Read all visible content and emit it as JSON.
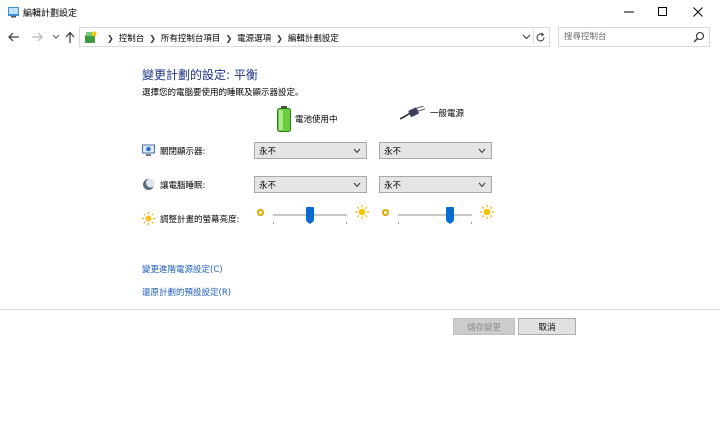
{
  "window": {
    "title": "編輯計劃設定"
  },
  "address": {
    "crumbs": [
      "控制台",
      "所有控制台項目",
      "電源選項",
      "編輯計劃設定"
    ],
    "search_placeholder": "搜尋控制台"
  },
  "page": {
    "title": "變更計劃的設定: 平衡",
    "subtitle": "選擇您的電腦要使用的睡眠及顯示器設定。"
  },
  "columns": {
    "battery": "電池使用中",
    "plugged": "一般電源"
  },
  "rows": {
    "display": {
      "label": "關閉顯示器:",
      "battery": "永不",
      "plugged": "永不"
    },
    "sleep": {
      "label": "讓電腦睡眠:",
      "battery": "永不",
      "plugged": "永不"
    },
    "brightness": {
      "label": "調整計畫的螢幕亮度:",
      "battery_level": 0.5,
      "plugged_level": 0.7
    }
  },
  "links": {
    "advanced": "變更進階電源設定(C)",
    "restore": "還原計劃的預設設定(R)"
  },
  "buttons": {
    "save": "儲存變更",
    "cancel": "取消"
  },
  "colors": {
    "accent": "#0a6cd1",
    "title": "#1e3287",
    "link": "#1c5fb8"
  }
}
